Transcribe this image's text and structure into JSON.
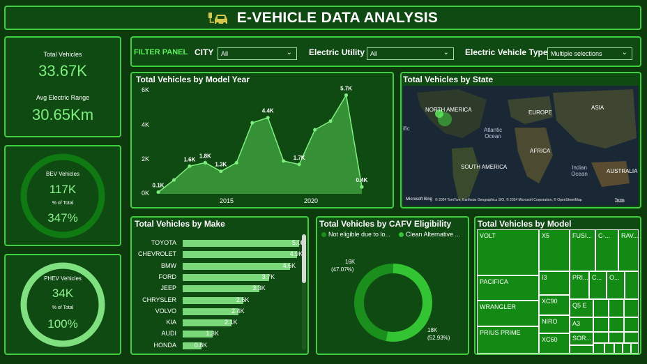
{
  "header": {
    "title": "E-VEHICLE DATA ANALYSIS",
    "icon": "ev-charging-car-icon",
    "accent": "#7ef07e"
  },
  "kpi": {
    "total_vehicles_label": "Total Vehicles",
    "total_vehicles_value": "33.67K",
    "avg_range_label": "Avg Electric Range",
    "avg_range_value": "30.65Km"
  },
  "bev": {
    "label": "BEV Vehicles",
    "value": "117K",
    "pct_label": "% of Total",
    "pct_value": "347%"
  },
  "phev": {
    "label": "PHEV Vehicles",
    "value": "34K",
    "pct_label": "% of Total",
    "pct_value": "100%"
  },
  "filters": {
    "panel_label": "FILTER PANEL",
    "city_label": "CITY",
    "city_value": "All",
    "utility_label": "Electric Utility",
    "utility_value": "All",
    "type_label": "Electric Vehicle Type",
    "type_value": "Multiple selections"
  },
  "year_chart": {
    "title": "Total Vehicles by Model Year",
    "y_ticks": [
      "6K",
      "4K",
      "2K",
      "0K"
    ],
    "x_ticks": [
      "2015",
      "2020"
    ]
  },
  "map": {
    "title": "Total Vehicles by State",
    "labels": [
      "NORTH AMERICA",
      "EUROPE",
      "ASIA",
      "Atlantic Ocean",
      "AFRICA",
      "SOUTH AMERICA",
      "Indian Ocean",
      "AUSTRALIA",
      "ific"
    ],
    "attribution": "© 2024 TomTom, Earthstar Geographics SIO, © 2024 Microsoft Corporation, © OpenStreetMap",
    "terms": "Terms",
    "brand": "Microsoft Bing"
  },
  "make_chart": {
    "title": "Total Vehicles by Make"
  },
  "cafv": {
    "title": "Total Vehicles by CAFV Eligibility",
    "legend": [
      "Not eligible due to lo...",
      "Clean Alternative ..."
    ],
    "label_a_value": "16K",
    "label_a_pct": "(47.07%)",
    "label_b_value": "18K",
    "label_b_pct": "(52.93%)",
    "colors": [
      "#1b8f1b",
      "#33c433"
    ]
  },
  "model": {
    "title": "Total Vehicles by Model",
    "cells": [
      "VOLT",
      "X5",
      "FUSI...",
      "C-...",
      "RAV...",
      "PACIFICA",
      "I3",
      "PRI...",
      "C...",
      "O...",
      "XC90",
      "Q5 E",
      "WRANGLER",
      "NIRO",
      "A3",
      "PRIUS PRIME",
      "XC60",
      "SOR..."
    ]
  },
  "chart_data": [
    {
      "type": "area",
      "title": "Total Vehicles by Model Year",
      "x": [
        2011,
        2012,
        2013,
        2014,
        2015,
        2016,
        2017,
        2018,
        2019,
        2020,
        2021,
        2022,
        2023,
        2024
      ],
      "values": [
        0.1,
        0.8,
        1.6,
        1.8,
        1.3,
        1.8,
        4.1,
        4.4,
        1.9,
        1.7,
        3.7,
        4.2,
        5.7,
        0.4
      ],
      "data_labels": [
        {
          "x": 2011,
          "text": "0.1K"
        },
        {
          "x": 2013,
          "text": "1.6K"
        },
        {
          "x": 2014,
          "text": "1.8K"
        },
        {
          "x": 2015,
          "text": "1.3K"
        },
        {
          "x": 2018,
          "text": "4.4K"
        },
        {
          "x": 2020,
          "text": "1.7K"
        },
        {
          "x": 2023,
          "text": "5.7K"
        },
        {
          "x": 2024,
          "text": "0.4K"
        }
      ],
      "ylim": [
        0,
        6
      ],
      "xlim": [
        2011,
        2024
      ]
    },
    {
      "type": "bar",
      "title": "Total Vehicles by Make",
      "categories": [
        "TOYOTA",
        "CHEVROLET",
        "BMW",
        "FORD",
        "JEEP",
        "CHRYSLER",
        "VOLVO",
        "KIA",
        "AUDI",
        "HONDA"
      ],
      "values": [
        5.0,
        4.9,
        4.6,
        3.7,
        3.3,
        2.6,
        2.4,
        2.1,
        1.3,
        0.8
      ],
      "value_labels": [
        "5.0K",
        "4.9K",
        "4.6K",
        "3.7K",
        "3.3K",
        "2.6K",
        "2.4K",
        "2.1K",
        "1.3K",
        "0.8K"
      ],
      "xlim": [
        0,
        5.0
      ]
    },
    {
      "type": "pie",
      "title": "Total Vehicles by CAFV Eligibility",
      "categories": [
        "Not eligible due to lo...",
        "Clean Alternative ..."
      ],
      "values": [
        47.07,
        52.93
      ]
    }
  ]
}
